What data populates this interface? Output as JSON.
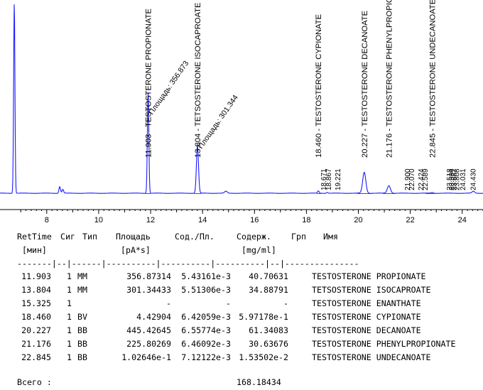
{
  "chart_data": {
    "type": "line",
    "xlim": [
      6.2,
      24.8
    ],
    "x_ticks": [
      "8",
      "10",
      "12",
      "14",
      "16",
      "18",
      "20",
      "22",
      "24"
    ],
    "peaks": [
      {
        "rt": 6.75,
        "height": 1.0,
        "width": 0.025,
        "label": ""
      },
      {
        "rt": 8.5,
        "height": 0.035,
        "width": 0.03,
        "label": ""
      },
      {
        "rt": 8.62,
        "height": 0.02,
        "width": 0.03,
        "label": ""
      },
      {
        "rt": 11.903,
        "height": 0.53,
        "width": 0.028,
        "label": "11.903 - TESTOSTERONE PROPIONATE",
        "area_label": "Площадь: 356.873"
      },
      {
        "rt": 13.804,
        "height": 0.25,
        "width": 0.04,
        "label": "13.804 - TETSOSTERONE ISOCAPROATE",
        "area_label": "Площадь: 301.344"
      },
      {
        "rt": 14.9,
        "height": 0.01,
        "width": 0.05,
        "label": ""
      },
      {
        "rt": 18.46,
        "height": 0.012,
        "width": 0.03,
        "label": "18.460 - TESTOSTERONE CYPIONATE"
      },
      {
        "rt": 18.8,
        "height": 0.005,
        "width": 0.03,
        "label": "18.867"
      },
      {
        "rt": 20.227,
        "height": 0.11,
        "width": 0.06,
        "label": "20.227 - TESTOSTERONE DECANOATE"
      },
      {
        "rt": 21.176,
        "height": 0.04,
        "width": 0.06,
        "label": "21.176 - TESTOSTERONE PHENYLPROPIONATE"
      },
      {
        "rt": 22.845,
        "height": 0.004,
        "width": 0.04,
        "label": "22.845 - TESTOSTERONE UNDECANOATE"
      },
      {
        "rt": 24.43,
        "height": 0.01,
        "width": 0.05,
        "label": ""
      }
    ],
    "small_labels": [
      "18.671",
      "18.867",
      "19.221",
      "21.900",
      "22.070",
      "22.424",
      "22.589",
      "23.518",
      "23.594",
      "23.687",
      "23.808",
      "24.031",
      "24.430"
    ]
  },
  "table": {
    "header1": {
      "rt": "RetTime",
      "sig": "Сиг",
      "type": "Тип",
      "area": "Площадь",
      "ratio": "Сод./Пл.",
      "amount": "Содерж.",
      "grp": "Грп",
      "name": "Имя"
    },
    "header2": {
      "rt": "[мин]",
      "area": "[pA*s]",
      "amount": "[mg/ml]"
    },
    "separator": "-------|--|------|----------|----------|----------|--|---------------",
    "rows": [
      {
        "rt": "11.903",
        "sig": "1",
        "type": "MM",
        "area": "356.87314",
        "ratio": "5.43161e-3",
        "amount": "40.70631",
        "name": "TESTOSTERONE PROPIONATE"
      },
      {
        "rt": "13.804",
        "sig": "1",
        "type": "MM",
        "area": "301.34433",
        "ratio": "5.51306e-3",
        "amount": "34.88791",
        "name": "TETSOSTERONE ISOCAPROATE"
      },
      {
        "rt": "15.325",
        "sig": "1",
        "type": "",
        "area": "-",
        "ratio": "-",
        "amount": "-",
        "name": "TESTOSTERONE ENANTHATE"
      },
      {
        "rt": "18.460",
        "sig": "1",
        "type": "BV",
        "area": "4.42904",
        "ratio": "6.42059e-3",
        "amount": "5.97178e-1",
        "name": "TESTOSTERONE CYPIONATE"
      },
      {
        "rt": "20.227",
        "sig": "1",
        "type": "BB",
        "area": "445.42645",
        "ratio": "6.55774e-3",
        "amount": "61.34083",
        "name": "TESTOSTERONE DECANOATE"
      },
      {
        "rt": "21.176",
        "sig": "1",
        "type": "BB",
        "area": "225.80269",
        "ratio": "6.46092e-3",
        "amount": "30.63676",
        "name": "TESTOSTERONE PHENYLPROPIONATE"
      },
      {
        "rt": "22.845",
        "sig": "1",
        "type": "BB",
        "area": "1.02646e-1",
        "ratio": "7.12122e-3",
        "amount": "1.53502e-2",
        "name": "TESTOSTERONE UNDECANOATE"
      }
    ],
    "total_label": "Всего :",
    "total_value": "168.18434"
  },
  "colors": {
    "trace": "#1a1aff",
    "baseline": "#cc00cc",
    "text": "#000000"
  }
}
